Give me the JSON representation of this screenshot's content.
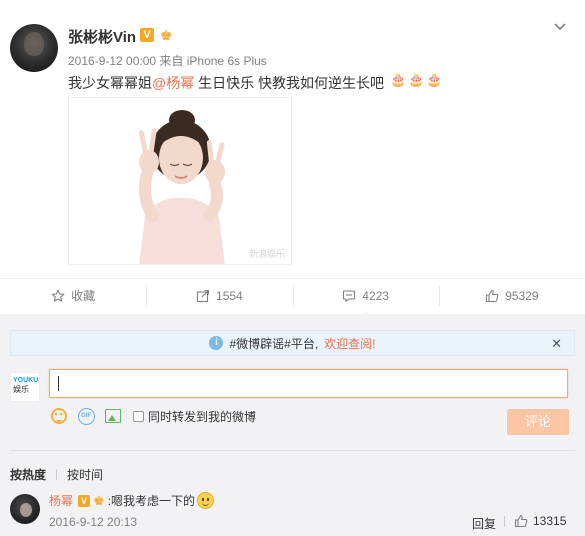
{
  "post": {
    "username": "张彬彬Vin",
    "verified_badge": "V",
    "meta": "2016-9-12 00:00 来自 iPhone 6s Plus",
    "text_before": "我少女幂幂姐",
    "mention": "@杨幂",
    "text_after": " 生日快乐  快教我如何逆生长吧",
    "cake_icons": [
      "cake-icon",
      "cake-icon",
      "cake-icon"
    ],
    "photo_watermark": "新浪娱乐"
  },
  "actions": [
    {
      "label": "收藏",
      "icon": "star-icon"
    },
    {
      "label": "1554",
      "icon": "repost-icon"
    },
    {
      "label": "4223",
      "icon": "comment-icon"
    },
    {
      "label": "95329",
      "icon": "like-icon"
    }
  ],
  "comments_panel": {
    "notice_prefix": "#微博辟谣#平台,",
    "notice_link": "欢迎查阅!",
    "my_avatar_brand": "YOUKU",
    "my_avatar_sub": "娱乐",
    "input_value": "",
    "repost_label": "同时转发到我的微博",
    "submit_label": "评论",
    "sort_hot": "按热度",
    "sort_time": "按时间"
  },
  "comment": {
    "author": "杨幂",
    "verified_badge": "V",
    "text": ":嗯我考虑一下的",
    "time": "2016-9-12 20:13",
    "reply_label": "回复",
    "likes": "13315"
  },
  "colors": {
    "accent": "#eb7350",
    "badge_gold": "#f5a623",
    "panel_bg": "#f2f2f5",
    "notice_bg": "#eaf3fb",
    "submit_disabled": "#fcc5a3"
  }
}
